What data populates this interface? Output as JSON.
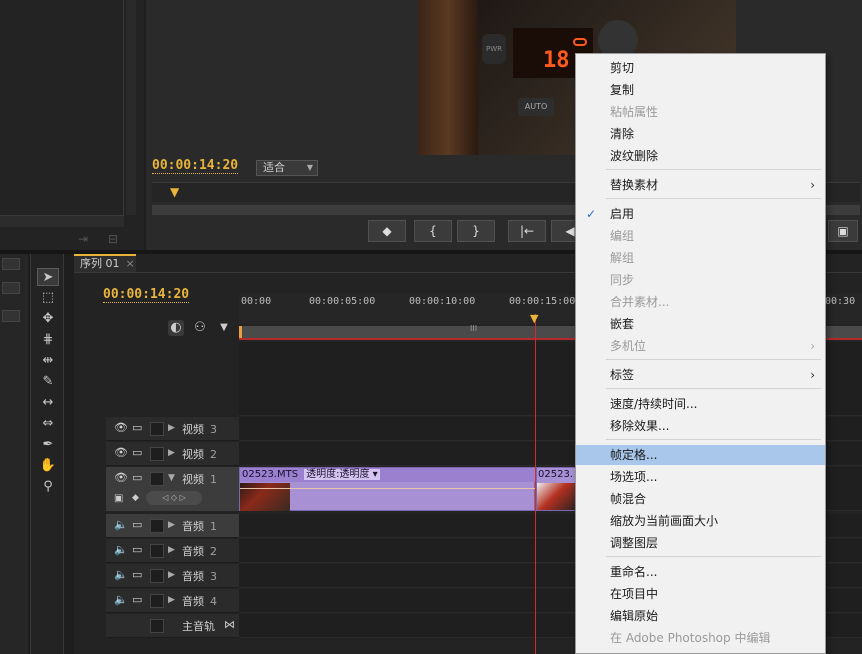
{
  "program_monitor": {
    "timecode": "00:00:14:20",
    "fit_label": "适合",
    "video": {
      "button_label": "PWR",
      "lcd_temp": "18",
      "auto_label": "AUTO"
    },
    "controls": [
      "◆",
      "{",
      "}",
      "|←",
      "◀"
    ]
  },
  "timeline": {
    "tab_label": "序列 01",
    "tab_close": "×",
    "timecode": "00:00:14:20",
    "ruler_ticks": [
      "00:00",
      "00:00:05:00",
      "00:00:10:00",
      "00:00:15:00",
      "00:30"
    ],
    "work_area_mark": "III",
    "tracks": {
      "video": [
        {
          "name": "视频",
          "num": "3"
        },
        {
          "name": "视频",
          "num": "2"
        },
        {
          "name": "视频",
          "num": "1"
        }
      ],
      "audio": [
        {
          "name": "音频",
          "num": "1"
        },
        {
          "name": "音频",
          "num": "2"
        },
        {
          "name": "音频",
          "num": "3"
        },
        {
          "name": "音频",
          "num": "4"
        }
      ],
      "master": {
        "name": "主音轨"
      }
    },
    "clip1": {
      "name": "02523.MTS",
      "effect": "透明度:透明度 ▾"
    },
    "clip2": {
      "name": "02523."
    }
  },
  "context_menu": {
    "items": [
      {
        "label": "剪切",
        "enabled": true
      },
      {
        "label": "复制",
        "enabled": true
      },
      {
        "label": "粘帖属性",
        "enabled": false
      },
      {
        "label": "清除",
        "enabled": true
      },
      {
        "label": "波纹删除",
        "enabled": true
      },
      {
        "label": "替换素材",
        "enabled": true,
        "submenu": true
      },
      {
        "label": "启用",
        "enabled": true,
        "checked": true
      },
      {
        "label": "编组",
        "enabled": false
      },
      {
        "label": "解组",
        "enabled": false
      },
      {
        "label": "同步",
        "enabled": false
      },
      {
        "label": "合并素材...",
        "enabled": false
      },
      {
        "label": "嵌套",
        "enabled": true
      },
      {
        "label": "多机位",
        "enabled": false,
        "submenu": true
      },
      {
        "label": "标签",
        "enabled": true,
        "submenu": true
      },
      {
        "label": "速度/持续时间...",
        "enabled": true
      },
      {
        "label": "移除效果...",
        "enabled": true
      },
      {
        "label": "帧定格...",
        "enabled": true,
        "highlighted": true
      },
      {
        "label": "场选项...",
        "enabled": true
      },
      {
        "label": "帧混合",
        "enabled": true
      },
      {
        "label": "缩放为当前画面大小",
        "enabled": true
      },
      {
        "label": "调整图层",
        "enabled": true
      },
      {
        "label": "重命名...",
        "enabled": true
      },
      {
        "label": "在项目中",
        "enabled": true
      },
      {
        "label": "编辑原始",
        "enabled": true
      },
      {
        "label": "在 Adobe Photoshop 中编辑",
        "enabled": false
      }
    ],
    "submenu_arrow": "›",
    "check_mark": "✓"
  },
  "colors": {
    "accent_timecode": "#e8b43a",
    "clip_purple": "#a790d4",
    "menu_highlight": "#a8c7ea",
    "playhead_red": "#c9302c"
  }
}
